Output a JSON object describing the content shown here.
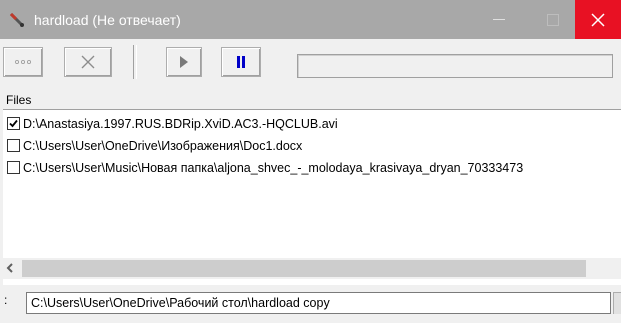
{
  "window": {
    "title": "hardload (Не отвечает)",
    "close_color": "#e81123",
    "titlebar_color": "#a8a8a8"
  },
  "toolbar": {
    "buttons": [
      {
        "name": "dots",
        "icon": "dots-icon"
      },
      {
        "name": "remove",
        "icon": "x-icon"
      },
      {
        "name": "start",
        "icon": "play-icon"
      },
      {
        "name": "pause",
        "icon": "pause-icon",
        "color": "#0000c8"
      }
    ],
    "progress_percent": 0
  },
  "files": {
    "header": "Files",
    "items": [
      {
        "path": "D:\\Anastasiya.1997.RUS.BDRip.XviD.AC3.-HQCLUB.avi",
        "checked": true
      },
      {
        "path": "C:\\Users\\User\\OneDrive\\Изображения\\Doc1.docx",
        "checked": false
      },
      {
        "path": "C:\\Users\\User\\Music\\Новая папка\\aljona_shvec_-_molodaya_krasivaya_dryan_70333473",
        "checked": false
      }
    ]
  },
  "path_field": {
    "label": ":",
    "value": "C:\\Users\\User\\OneDrive\\Рабочий стол\\hardload copy"
  }
}
